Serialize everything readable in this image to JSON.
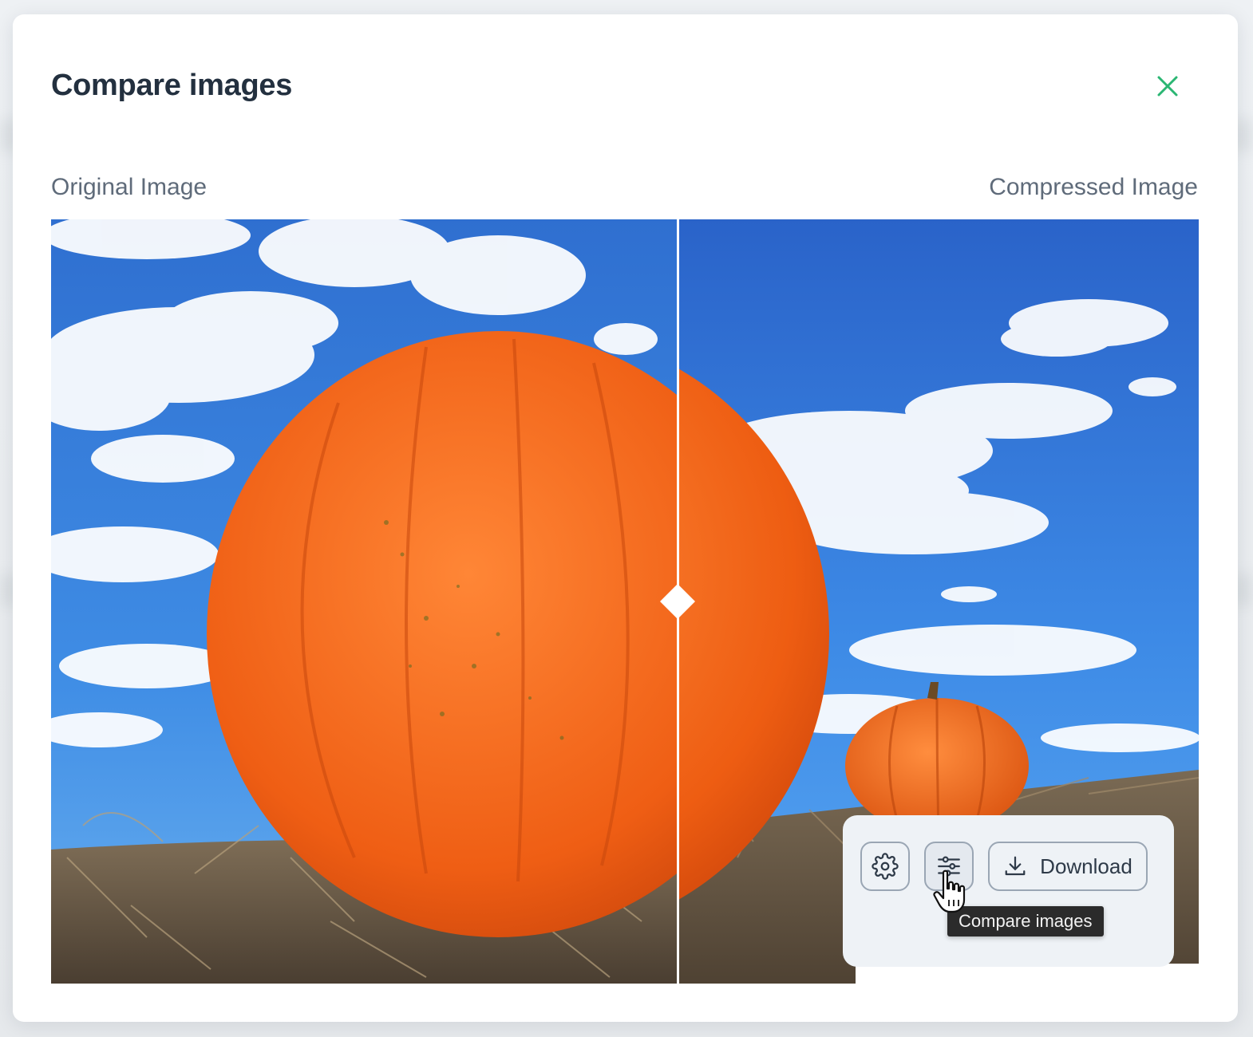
{
  "modal": {
    "title": "Compare images"
  },
  "labels": {
    "original": "Original Image",
    "compressed": "Compressed Image"
  },
  "toolbar": {
    "download_label": "Download",
    "tooltip": "Compare images"
  },
  "icons": {
    "close": "close-icon",
    "settings": "gear-icon",
    "compare": "sliders-icon",
    "download": "download-icon",
    "cursor": "hand-pointer-cursor"
  },
  "colors": {
    "accent": "#2bb673",
    "title": "#23303f",
    "sky": "#2f74d6",
    "pumpkin": "#f0661a"
  }
}
